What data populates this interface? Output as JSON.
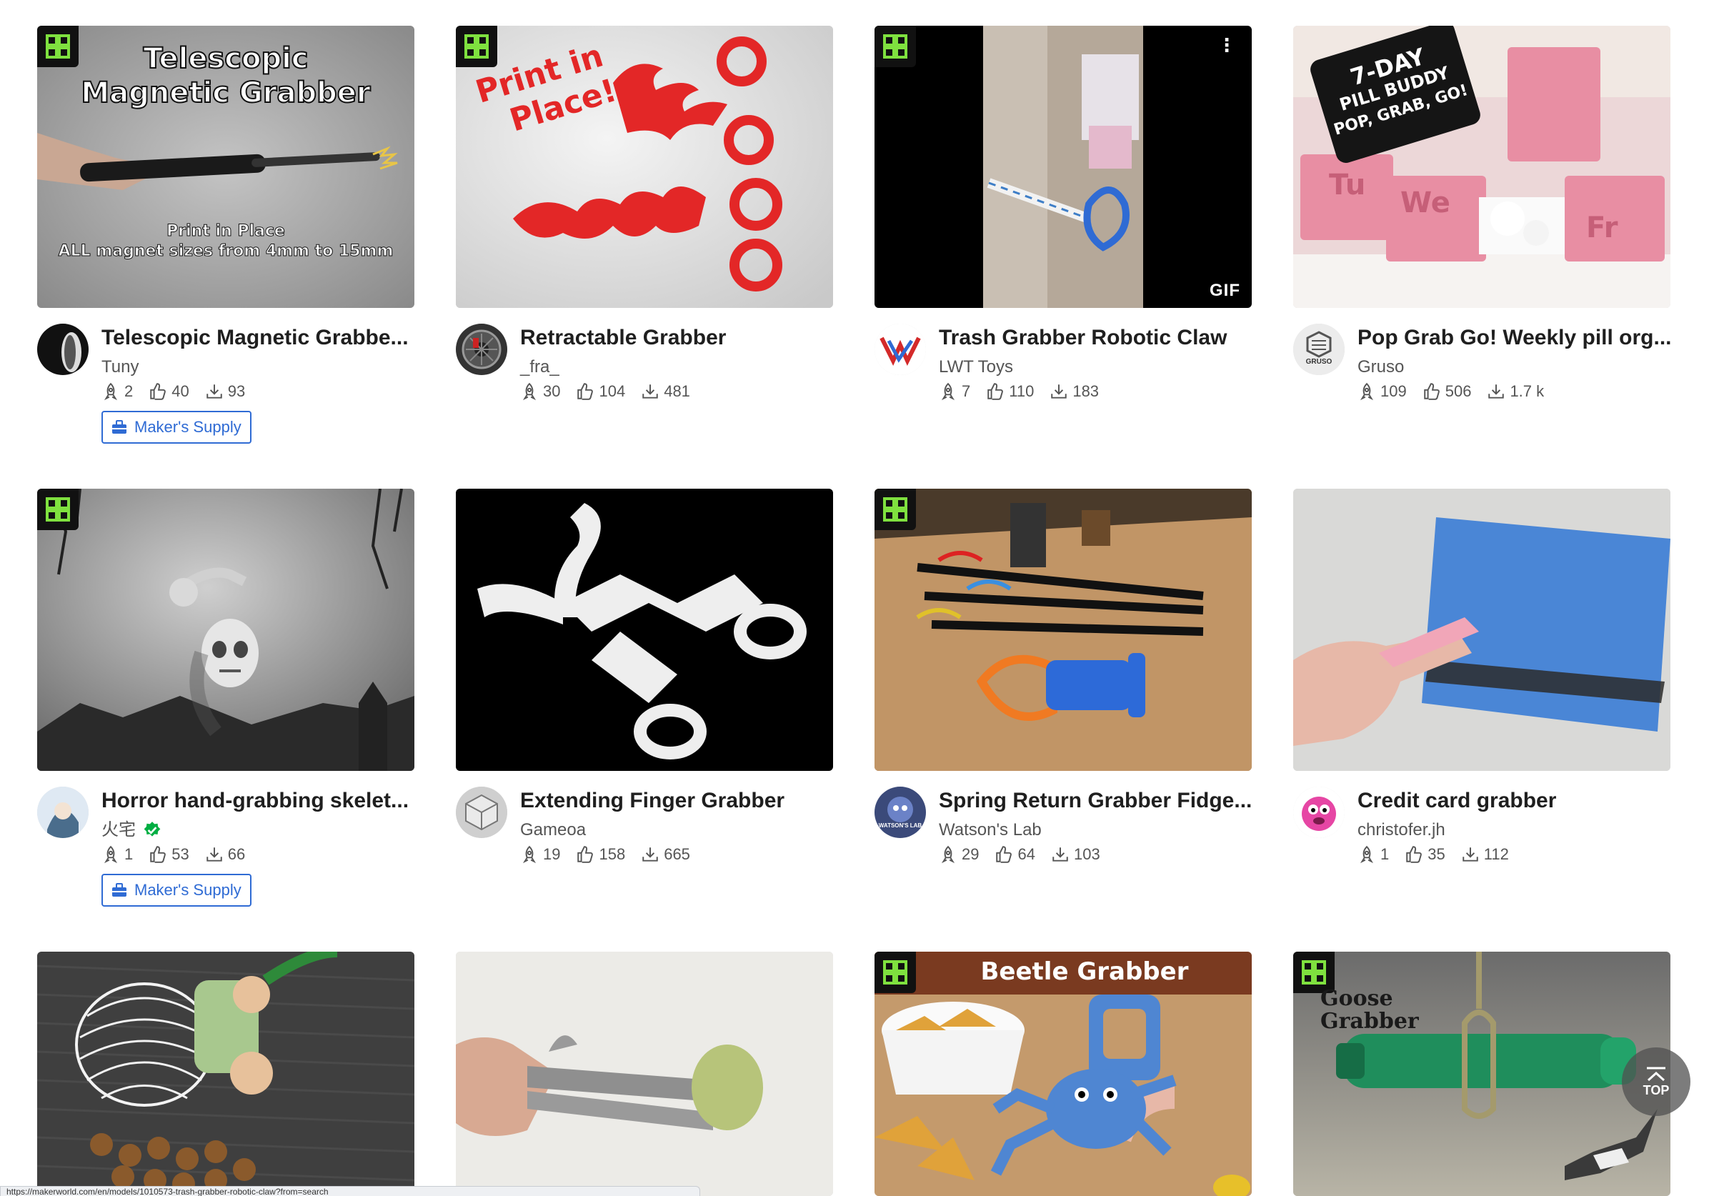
{
  "cards": [
    {
      "title": "Telescopic Magnetic Grabbe...",
      "author": "Tuny",
      "boosts": "2",
      "likes": "40",
      "downloads": "93",
      "maker_label": "Maker's Supply",
      "badge": true,
      "overlay_lines": [
        "Telescopic",
        "Magnetic Grabber",
        "Print in Place",
        "ALL magnet sizes from 4mm to 15mm"
      ]
    },
    {
      "title": "Retractable Grabber",
      "author": "_fra_",
      "boosts": "30",
      "likes": "104",
      "downloads": "481",
      "badge": true,
      "overlay_lines": [
        "Print in",
        "Place!"
      ]
    },
    {
      "title": "Trash Grabber Robotic Claw",
      "author": "LWT Toys",
      "boosts": "7",
      "likes": "110",
      "downloads": "183",
      "badge": true,
      "gif_label": "GIF",
      "more_icon": "⋮"
    },
    {
      "title": "Pop Grab Go! Weekly pill org...",
      "author": "Gruso",
      "boosts": "109",
      "likes": "506",
      "downloads": "1.7 k",
      "overlay_lines": [
        "7-DAY",
        "PILL BUDDY",
        "POP, GRAB, GO!",
        "Tu",
        "We",
        "Fr"
      ],
      "avatar_text": "GRUSO"
    },
    {
      "title": "Horror hand-grabbing skelet...",
      "author": "火宅",
      "verified": true,
      "boosts": "1",
      "likes": "53",
      "downloads": "66",
      "maker_label": "Maker's Supply",
      "badge": true
    },
    {
      "title": "Extending Finger Grabber",
      "author": "Gameoa",
      "boosts": "19",
      "likes": "158",
      "downloads": "665"
    },
    {
      "title": "Spring Return Grabber Fidge...",
      "author": "Watson's Lab",
      "boosts": "29",
      "likes": "64",
      "downloads": "103",
      "badge": true,
      "avatar_text": "WATSON'S LAB"
    },
    {
      "title": "Credit card grabber",
      "author": "christofer.jh",
      "boosts": "1",
      "likes": "35",
      "downloads": "112"
    },
    {
      "badge": false
    },
    {
      "badge": false
    },
    {
      "badge": true,
      "overlay_lines": [
        "Beetle Grabber"
      ]
    },
    {
      "badge": true,
      "overlay_lines": [
        "Goose",
        "Grabber"
      ]
    }
  ],
  "top_button": {
    "label": "TOP"
  },
  "status_bar": {
    "text": "https://makerworld.com/en/models/1010573-trash-grabber-robotic-claw?from=search"
  },
  "colors": {
    "accent": "#2f6bd4",
    "badge_bg": "#111111",
    "badge_fg": "#00ae42"
  }
}
